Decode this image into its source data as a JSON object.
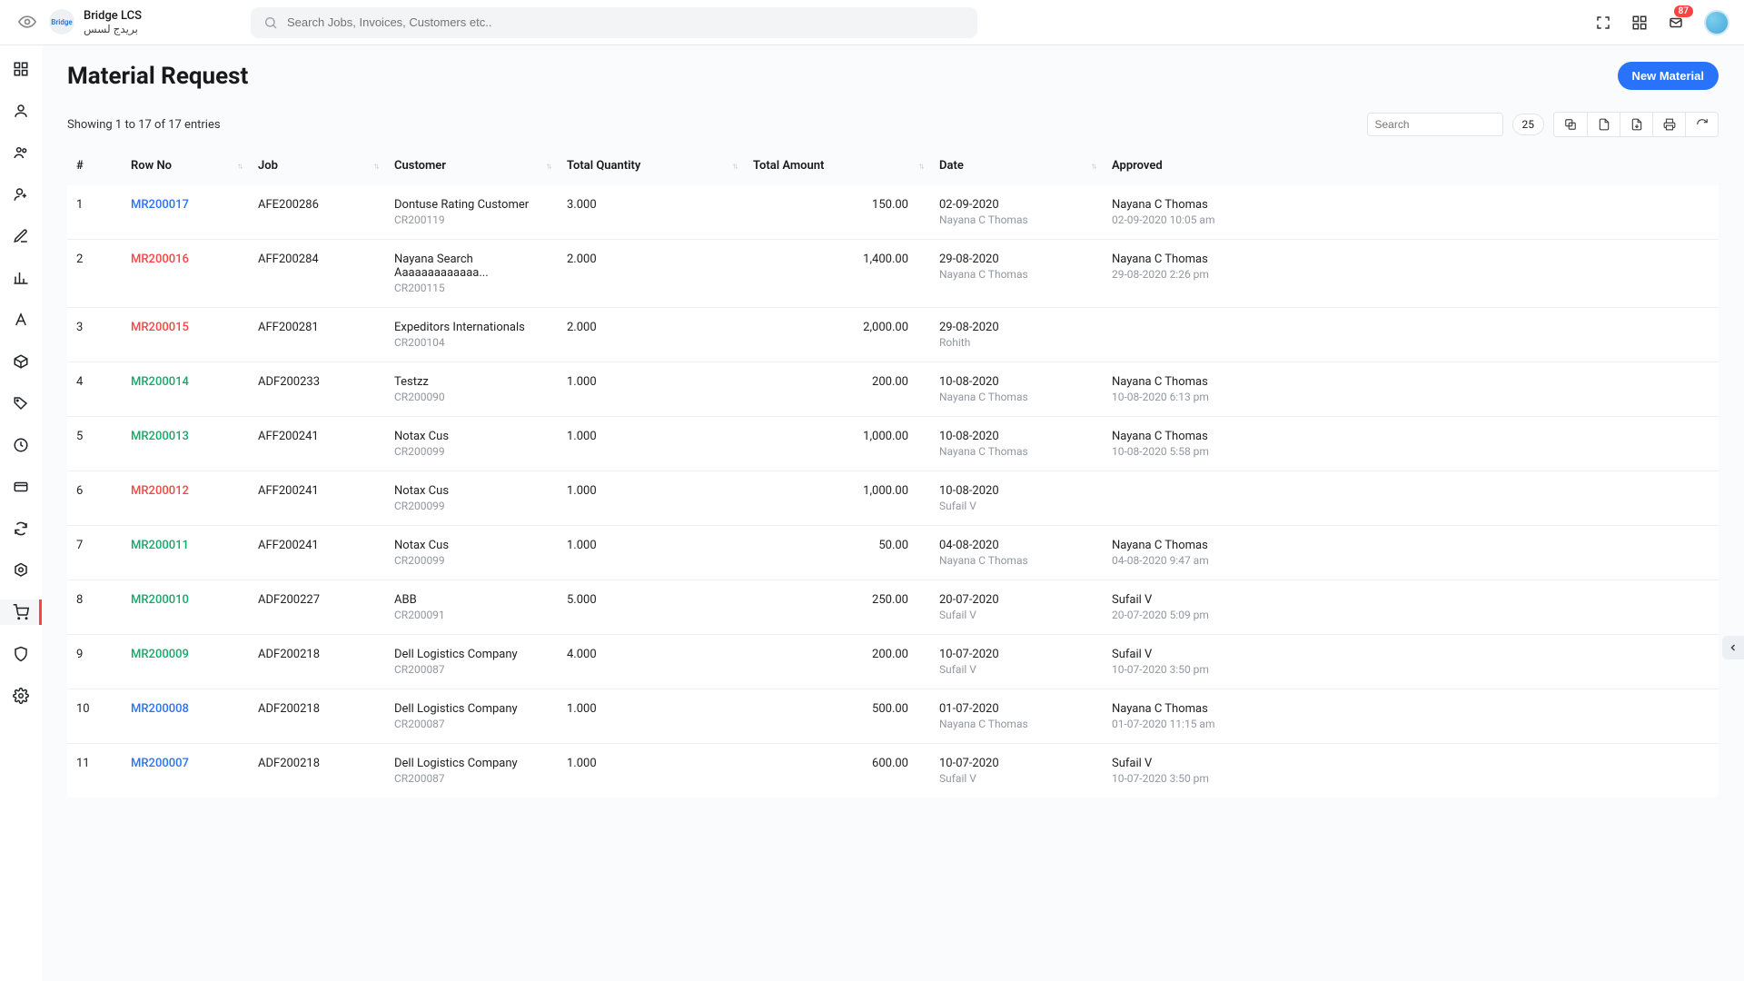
{
  "brand": {
    "title": "Bridge LCS",
    "subtitle": "بريدج لسس",
    "logo_text": "Bridge"
  },
  "search": {
    "placeholder": "Search Jobs, Invoices, Customers etc.."
  },
  "notifications": {
    "count": "87"
  },
  "page": {
    "title": "Material Request",
    "new_button": "New Material"
  },
  "table_meta": {
    "showing_text": "Showing 1 to 17 of 17 entries",
    "table_search_placeholder": "Search",
    "page_size": "25"
  },
  "columns": {
    "hash": "#",
    "row_no": "Row No",
    "job": "Job",
    "customer": "Customer",
    "total_qty": "Total Quantity",
    "total_amount": "Total Amount",
    "date": "Date",
    "approved": "Approved"
  },
  "rows": [
    {
      "idx": "1",
      "row_no": "MR200017",
      "status": "blue",
      "job": "AFE200286",
      "customer": "Dontuse Rating Customer",
      "cust_code": "CR200119",
      "qty": "3.000",
      "amount": "150.00",
      "date": "02-09-2020",
      "date_sub": "Nayana C Thomas",
      "approved": "Nayana C Thomas",
      "approved_sub": "02-09-2020 10:05 am"
    },
    {
      "idx": "2",
      "row_no": "MR200016",
      "status": "red",
      "job": "AFF200284",
      "customer": "Nayana Search Aaaaaaaaaaaaa...",
      "cust_code": "CR200115",
      "qty": "2.000",
      "amount": "1,400.00",
      "date": "29-08-2020",
      "date_sub": "Nayana C Thomas",
      "approved": "Nayana C Thomas",
      "approved_sub": "29-08-2020 2:26 pm"
    },
    {
      "idx": "3",
      "row_no": "MR200015",
      "status": "red",
      "job": "AFF200281",
      "customer": "Expeditors Internationals",
      "cust_code": "CR200104",
      "qty": "2.000",
      "amount": "2,000.00",
      "date": "29-08-2020",
      "date_sub": "Rohith",
      "approved": "",
      "approved_sub": ""
    },
    {
      "idx": "4",
      "row_no": "MR200014",
      "status": "green",
      "job": "ADF200233",
      "customer": "Testzz",
      "cust_code": "CR200090",
      "qty": "1.000",
      "amount": "200.00",
      "date": "10-08-2020",
      "date_sub": "Nayana C Thomas",
      "approved": "Nayana C Thomas",
      "approved_sub": "10-08-2020 6:13 pm"
    },
    {
      "idx": "5",
      "row_no": "MR200013",
      "status": "green",
      "job": "AFF200241",
      "customer": "Notax Cus",
      "cust_code": "CR200099",
      "qty": "1.000",
      "amount": "1,000.00",
      "date": "10-08-2020",
      "date_sub": "Nayana C Thomas",
      "approved": "Nayana C Thomas",
      "approved_sub": "10-08-2020 5:58 pm"
    },
    {
      "idx": "6",
      "row_no": "MR200012",
      "status": "red",
      "job": "AFF200241",
      "customer": "Notax Cus",
      "cust_code": "CR200099",
      "qty": "1.000",
      "amount": "1,000.00",
      "date": "10-08-2020",
      "date_sub": "Sufail V",
      "approved": "",
      "approved_sub": ""
    },
    {
      "idx": "7",
      "row_no": "MR200011",
      "status": "green",
      "job": "AFF200241",
      "customer": "Notax Cus",
      "cust_code": "CR200099",
      "qty": "1.000",
      "amount": "50.00",
      "date": "04-08-2020",
      "date_sub": "Nayana C Thomas",
      "approved": "Nayana C Thomas",
      "approved_sub": "04-08-2020 9:47 am"
    },
    {
      "idx": "8",
      "row_no": "MR200010",
      "status": "green",
      "job": "ADF200227",
      "customer": "ABB",
      "cust_code": "CR200091",
      "qty": "5.000",
      "amount": "250.00",
      "date": "20-07-2020",
      "date_sub": "Sufail V",
      "approved": "Sufail V",
      "approved_sub": "20-07-2020 5:09 pm"
    },
    {
      "idx": "9",
      "row_no": "MR200009",
      "status": "green",
      "job": "ADF200218",
      "customer": "Dell Logistics Company",
      "cust_code": "CR200087",
      "qty": "4.000",
      "amount": "200.00",
      "date": "10-07-2020",
      "date_sub": "Sufail V",
      "approved": "Sufail V",
      "approved_sub": "10-07-2020 3:50 pm"
    },
    {
      "idx": "10",
      "row_no": "MR200008",
      "status": "blue",
      "job": "ADF200218",
      "customer": "Dell Logistics Company",
      "cust_code": "CR200087",
      "qty": "1.000",
      "amount": "500.00",
      "date": "01-07-2020",
      "date_sub": "Nayana C Thomas",
      "approved": "Nayana C Thomas",
      "approved_sub": "01-07-2020 11:15 am"
    },
    {
      "idx": "11",
      "row_no": "MR200007",
      "status": "blue",
      "job": "ADF200218",
      "customer": "Dell Logistics Company",
      "cust_code": "CR200087",
      "qty": "1.000",
      "amount": "600.00",
      "date": "10-07-2020",
      "date_sub": "Sufail V",
      "approved": "Sufail V",
      "approved_sub": "10-07-2020 3:50 pm"
    }
  ],
  "sidebar_icons": [
    "eye-icon",
    "user-icon",
    "team-icon",
    "user-add-icon",
    "edit-icon",
    "chart-icon",
    "a-icon",
    "box-icon",
    "tag-icon",
    "clock-icon",
    "card-icon",
    "sync-icon",
    "hex-icon",
    "cart-icon",
    "shield-icon",
    "gear-icon"
  ]
}
